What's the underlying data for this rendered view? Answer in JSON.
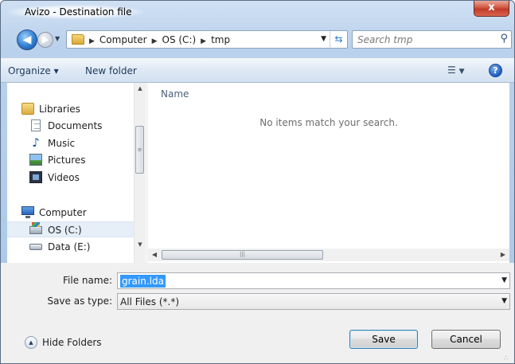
{
  "window": {
    "title": "Avizo - Destination file",
    "close_glyph": "x"
  },
  "nav": {
    "back_icon": "arrow-left-icon",
    "forward_icon": "arrow-right-icon",
    "breadcrumbs": [
      "Computer",
      "OS (C:)",
      "tmp"
    ],
    "search_placeholder": "Search tmp"
  },
  "toolbar": {
    "organize_label": "Organize ▾",
    "new_folder_label": "New folder",
    "help_glyph": "?"
  },
  "sidebar": {
    "items": [
      {
        "label": "Libraries",
        "icon": "libraries-icon"
      },
      {
        "label": "Documents",
        "icon": "documents-icon"
      },
      {
        "label": "Music",
        "icon": "music-icon"
      },
      {
        "label": "Pictures",
        "icon": "pictures-icon"
      },
      {
        "label": "Videos",
        "icon": "videos-icon"
      },
      {
        "label": "Computer",
        "icon": "computer-icon"
      },
      {
        "label": "OS (C:)",
        "icon": "drive-icon",
        "selected": true
      },
      {
        "label": "Data (E:)",
        "icon": "drive-icon"
      }
    ]
  },
  "file_list": {
    "column_name": "Name",
    "empty_message": "No items match your search."
  },
  "form": {
    "file_name_label": "File name:",
    "file_name_value": "grain.lda",
    "save_type_label": "Save as type:",
    "save_type_value": "All Files (*.*)"
  },
  "footer": {
    "hide_folders_label": "Hide Folders",
    "save_label": "Save",
    "cancel_label": "Cancel"
  },
  "colors": {
    "selection": "#3399ff",
    "frame": "#b9d1ec",
    "close_button": "#c0392b"
  }
}
